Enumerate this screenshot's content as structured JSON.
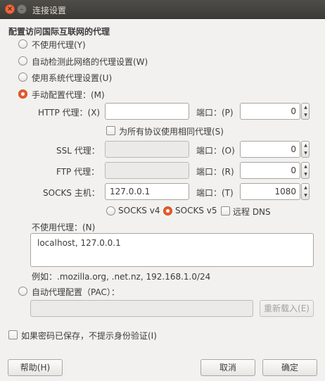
{
  "window": {
    "title": "连接设置"
  },
  "config_heading": "配置访问国际互联网的代理",
  "proxy_modes": [
    {
      "label": "不使用代理(Y)",
      "selected": false
    },
    {
      "label": "自动检测此网络的代理设置(W)",
      "selected": false
    },
    {
      "label": "使用系统代理设置(U)",
      "selected": false
    },
    {
      "label": "手动配置代理：(M)",
      "selected": true
    }
  ],
  "manual": {
    "http_label": "HTTP 代理：(X)",
    "http_host": "",
    "http_port_label": "端口：(P)",
    "http_port": "0",
    "same_proxy_label": "为所有协议使用相同代理(S)",
    "ssl_label": "SSL 代理：",
    "ssl_host": "",
    "ssl_port_label": "端口：(O)",
    "ssl_port": "0",
    "ftp_label": "FTP 代理：",
    "ftp_host": "",
    "ftp_port_label": "端口：(R)",
    "ftp_port": "0",
    "socks_label": "SOCKS 主机：",
    "socks_host": "127.0.0.1",
    "socks_port_label": "端口：(T)",
    "socks_port": "1080",
    "socks_v4_label": "SOCKS v4",
    "socks_v5_label": "SOCKS v5",
    "remote_dns_label": "远程 DNS",
    "socks_version_selected": "SOCKS v5"
  },
  "no_proxy": {
    "label": "不使用代理：(N)",
    "value": "localhost, 127.0.0.1",
    "example": "例如：.mozilla.org, .net.nz, 192.168.1.0/24"
  },
  "pac": {
    "label": "自动代理配置（PAC）：",
    "url": "",
    "reload_label": "重新载入(E)"
  },
  "no_prompt_auth_label": "如果密码已保存，不提示身份验证(I)",
  "buttons": {
    "help": "帮助(H)",
    "cancel": "取消",
    "ok": "确定"
  },
  "colors": {
    "accent": "#e9592b",
    "titlebar": "#3c3b37"
  }
}
